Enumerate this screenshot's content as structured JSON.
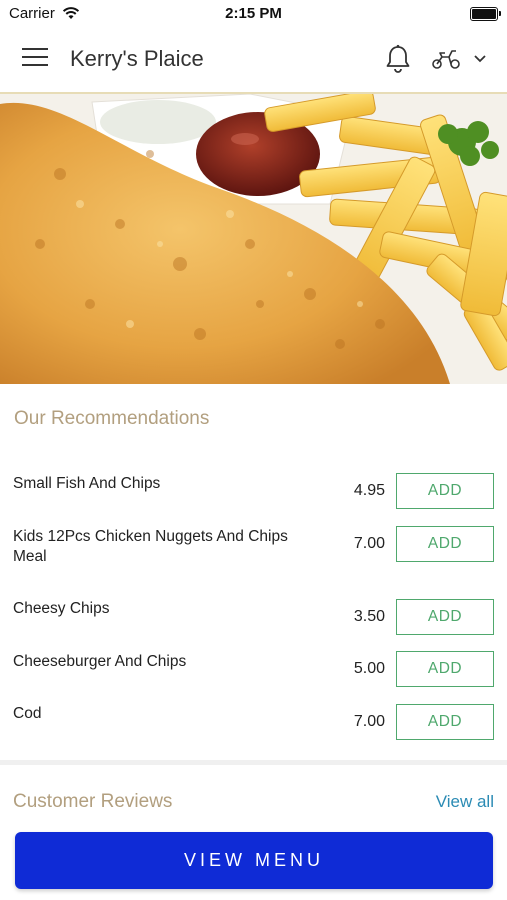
{
  "status_bar": {
    "carrier": "Carrier",
    "time": "2:15 PM"
  },
  "header": {
    "title": "Kerry's Plaice",
    "icons": [
      "menu-icon",
      "bell-icon",
      "scooter-icon",
      "chevron-down-icon"
    ]
  },
  "hero": {
    "image": "fish-and-chips-photo"
  },
  "recommendations": {
    "title": "Our Recommendations",
    "items": [
      {
        "name": "Small Fish And Chips",
        "price": "4.95",
        "button": "ADD"
      },
      {
        "name": "Kids 12Pcs Chicken Nuggets And Chips Meal",
        "price": "7.00",
        "button": "ADD"
      },
      {
        "name": "Cheesy Chips",
        "price": "3.50",
        "button": "ADD"
      },
      {
        "name": "Cheeseburger And Chips",
        "price": "5.00",
        "button": "ADD"
      },
      {
        "name": "Cod",
        "price": "7.00",
        "button": "ADD"
      }
    ]
  },
  "reviews": {
    "title": "Customer Reviews",
    "view_all": "View all"
  },
  "footer": {
    "view_menu": "VIEW MENU"
  },
  "colors": {
    "accent_gold": "#b29f7f",
    "add_green": "#4fa86d",
    "link_blue": "#2b8bb4",
    "primary_button": "#0f2bd6"
  }
}
